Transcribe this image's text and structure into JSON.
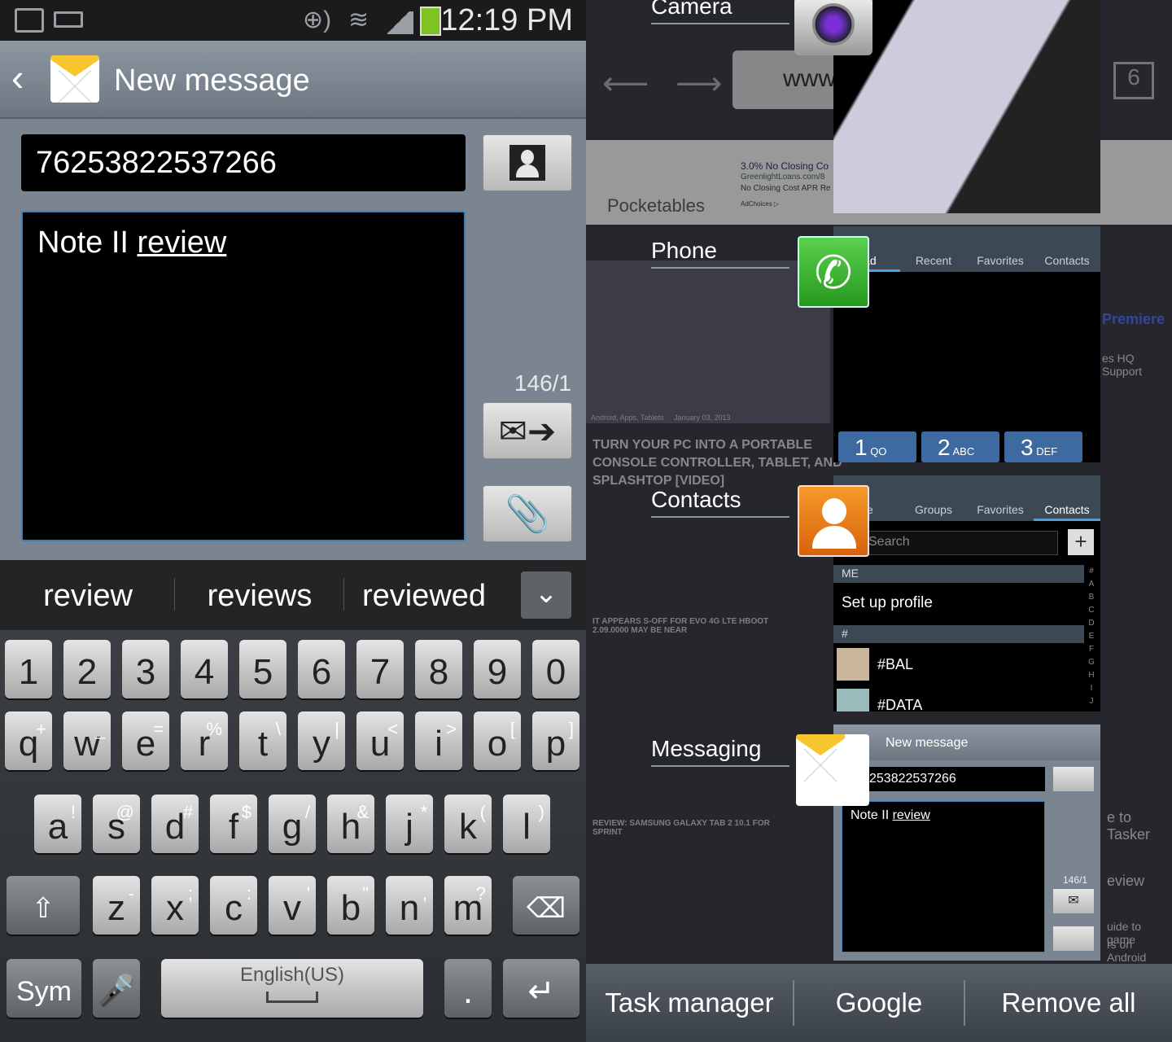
{
  "status": {
    "time": "12:19 PM"
  },
  "compose": {
    "title": "New message",
    "recipient": "76253822537266",
    "body_plain": "Note II ",
    "body_underlined": "review",
    "counter": "146/1"
  },
  "suggestions": [
    "review",
    "reviews",
    "reviewed"
  ],
  "keyboard": {
    "numbers": [
      "1",
      "2",
      "3",
      "4",
      "5",
      "6",
      "7",
      "8",
      "9",
      "0"
    ],
    "row1": [
      {
        "k": "q",
        "s": "+"
      },
      {
        "k": "w",
        "s": "_"
      },
      {
        "k": "e",
        "s": "="
      },
      {
        "k": "r",
        "s": "%"
      },
      {
        "k": "t",
        "s": "\\"
      },
      {
        "k": "y",
        "s": "|"
      },
      {
        "k": "u",
        "s": "<"
      },
      {
        "k": "i",
        "s": ">"
      },
      {
        "k": "o",
        "s": "["
      },
      {
        "k": "p",
        "s": "]"
      }
    ],
    "row2": [
      {
        "k": "a",
        "s": "!"
      },
      {
        "k": "s",
        "s": "@"
      },
      {
        "k": "d",
        "s": "#"
      },
      {
        "k": "f",
        "s": "$"
      },
      {
        "k": "g",
        "s": "/"
      },
      {
        "k": "h",
        "s": "&"
      },
      {
        "k": "j",
        "s": "*"
      },
      {
        "k": "k",
        "s": "("
      },
      {
        "k": "l",
        "s": ")"
      }
    ],
    "row3": [
      {
        "k": "z",
        "s": "-"
      },
      {
        "k": "x",
        "s": ";"
      },
      {
        "k": "c",
        "s": ":"
      },
      {
        "k": "v",
        "s": "'"
      },
      {
        "k": "b",
        "s": "\""
      },
      {
        "k": "n",
        "s": ","
      },
      {
        "k": "m",
        "s": "?"
      }
    ],
    "sym": "Sym",
    "space_label": "English(US)",
    "period": "."
  },
  "recent_apps": {
    "camera": "Camera",
    "phone": {
      "name": "Phone",
      "tabs": [
        "pad",
        "Recent",
        "Favorites",
        "Contacts"
      ],
      "keys": [
        {
          "n": "1",
          "l": "QO"
        },
        {
          "n": "2",
          "l": "ABC"
        },
        {
          "n": "3",
          "l": "DEF"
        }
      ]
    },
    "contacts": {
      "name": "Contacts",
      "tabs": [
        "ne",
        "Groups",
        "Favorites",
        "Contacts"
      ],
      "search_placeholder": "Search",
      "me_header": "ME",
      "setup": "Set up profile",
      "hash_header": "#",
      "entries": [
        "#BAL",
        "#DATA"
      ],
      "index": [
        "#",
        "A",
        "B",
        "C",
        "D",
        "E",
        "F",
        "G",
        "H",
        "I",
        "J"
      ]
    },
    "messaging": {
      "name": "Messaging",
      "title": "New message",
      "recipient": "253822537266",
      "body_plain": "Note II ",
      "body_underlined": "review",
      "counter": "146/1"
    }
  },
  "background_page": {
    "site": "Pocketables",
    "url_fragment": "www",
    "tab_count": "6",
    "ad_line": "3.0% No Closing Co",
    "ad_sub1": "GreenlightLoans.com/8",
    "ad_sub2": "No Closing Cost APR Re",
    "adchoices": "AdChoices ▷",
    "headline": "TURN YOUR PC INTO A PORTABLE CONSOLE CONTROLLER, TABLET, AND SPLASHTOP [VIDEO]",
    "category": "Android, Apps, Tablets",
    "date": "January 03, 2013",
    "premiere": "Premiere",
    "hq": "es HQ",
    "support": "Support",
    "story1": "IT APPEARS S-OFF FOR EVO 4G LTE HBOOT 2.09.0000 MAY BE NEAR",
    "story2": "REVIEW: SAMSUNG GALAXY TAB 2 10.1 FOR SPRINT",
    "side1": "e to Tasker",
    "side2": "eview",
    "side3": "uide to game",
    "side4": "rs on Android"
  },
  "bottom_bar": [
    "Task manager",
    "Google",
    "Remove all"
  ]
}
